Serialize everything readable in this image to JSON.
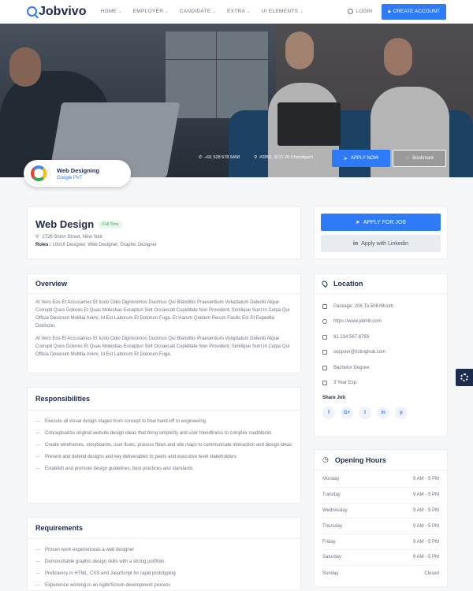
{
  "header": {
    "logo": "Jobvivo",
    "nav": [
      {
        "label": "HOME"
      },
      {
        "label": "EMPLOYER"
      },
      {
        "label": "CANDIDATE"
      },
      {
        "label": "EXTRA"
      },
      {
        "label": "UI ELEMENTS"
      }
    ],
    "login": "LOGIN",
    "create_account": "CREATE ACCOUNT"
  },
  "hero": {
    "phone": "+91 528 578 5458",
    "address": "#2852, SCO 20 Chandigarh",
    "apply_now": "APPLY NOW",
    "bookmark": "Bookmark",
    "company_name": "Web Designing",
    "company_sub": "Google PVT"
  },
  "job": {
    "title": "Web Design",
    "badge": "Full Time",
    "address": "2726 Shinn Street, New York",
    "roles_label": "Roles :",
    "roles": "UX/UI Designer, Web Designer, Graphic Designer"
  },
  "apply": {
    "apply_for_job": "APPLY FOR JOB",
    "linkedin": "Apply with Linkedin"
  },
  "overview": {
    "title": "Overview",
    "p1": "At Vero Eos Et Accusamus Et Iusto Odio Dignissimos Ducimus Qui Blanditiis Praesentium Voluptatum Deleniti Atque Corrupti Quos Dolores Et Quas Molestias Excepturi Sint Occaecati Cupiditate Non Provident, Similique Sunt In Culpa Qui Officia Deserunt Mollitia Animi, Id Est Laborum Et Dolorum Fuga. Et Harum Quidem Rerum Facilis Est Et Expedita Distinctio.",
    "p2": "At Vero Eos Et Accusamus Et Iusto Odio Dignissimos Ducimus Qui Blanditiis Praesentium Voluptatum Deleniti Atque Corrupti Quos Dolores Et Quas Molestias Excepturi Sint Occaecati Cupiditate Non Provident, Similique Sunt In Culpa Qui Officia Deserunt Mollitia Animi, Id Est Laborum Et Dolorum Fuga."
  },
  "location": {
    "title": "Location",
    "rows": [
      {
        "icon": "package-icon",
        "text": "Package: 20K To 50K/Month"
      },
      {
        "icon": "globe-icon",
        "text": "https://www.jobhill.com"
      },
      {
        "icon": "phone-icon",
        "text": "91 234 567 8765"
      },
      {
        "icon": "mail-icon",
        "text": "suppoer@listinghub.com"
      },
      {
        "icon": "graduation-icon",
        "text": "Bachelor Degree"
      },
      {
        "icon": "shield-icon",
        "text": "3 Year Exp."
      }
    ],
    "share_label": "Share Job",
    "socials": [
      "f",
      "G+",
      "t",
      "in",
      "p"
    ]
  },
  "responsibilities": {
    "title": "Responsibilities",
    "items": [
      "Execute all visual design stages from concept to final hand-off to engineering",
      "Conceptualize original website design ideas that bring simplicity and user friendliness to complex roadblocks",
      "Create wireframes, storyboards, user flows, process flows and site maps to communicate interaction and design ideas",
      "Present and defend designs and key deliverables to peers and executive level stakeholders",
      "Establish and promote design guidelines, best practices and standards"
    ]
  },
  "hours": {
    "title": "Opening Hours",
    "rows": [
      {
        "day": "Monday",
        "time": "9 AM - 5 PM"
      },
      {
        "day": "Tuesday",
        "time": "9 AM - 5 PM"
      },
      {
        "day": "Wednesday",
        "time": "9 AM - 5 PM"
      },
      {
        "day": "Thursday",
        "time": "9 AM - 5 PM"
      },
      {
        "day": "Friday",
        "time": "9 AM - 5 PM"
      },
      {
        "day": "Saturday",
        "time": "9 AM - 5 PM"
      },
      {
        "day": "Sunday",
        "time": "Closed"
      }
    ]
  },
  "requirements": {
    "title": "Requirements",
    "items": [
      "Proven work experienceas a web designer",
      "Demonstrable graphic design skills with a strong portfolio",
      "Proficiency in HTML, CSS and JavaScript for rapid prototyping",
      "Experience working in an Agile/Scrum development process"
    ]
  }
}
